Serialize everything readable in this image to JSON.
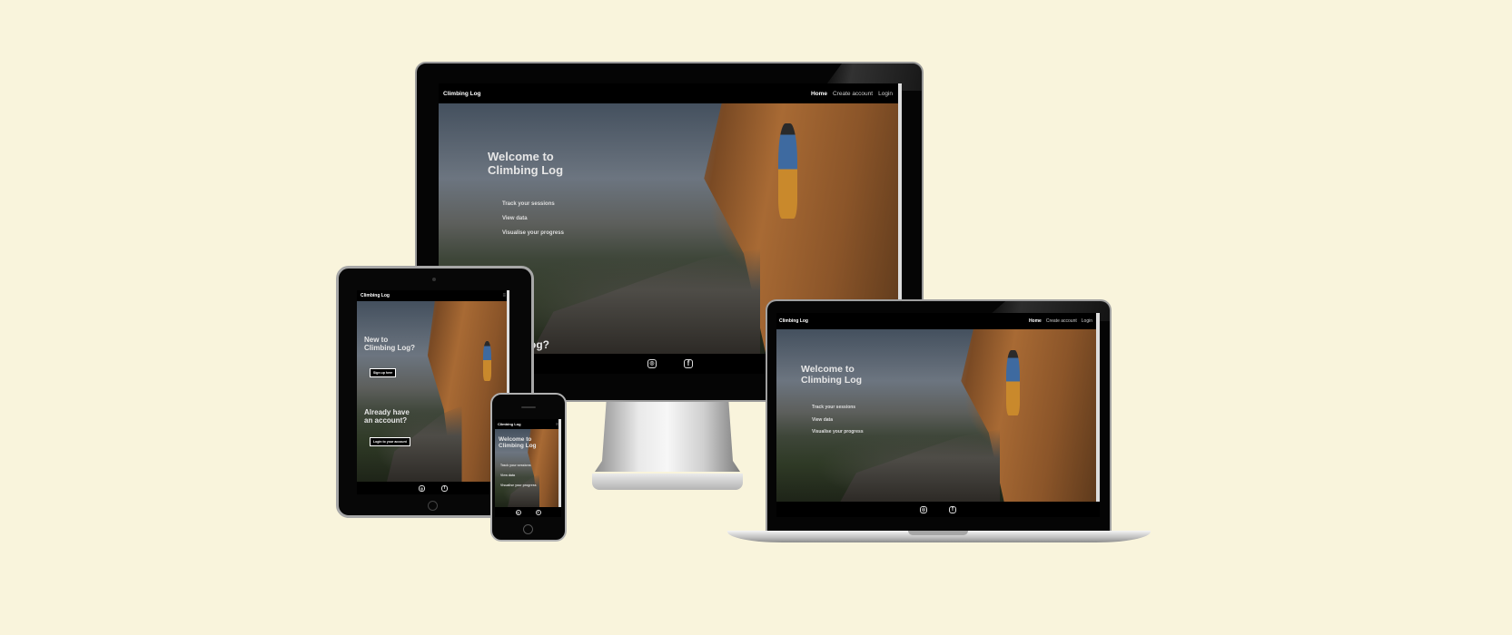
{
  "site": {
    "brand": "Climbing Log",
    "nav": [
      "Home",
      "Create account",
      "Login"
    ]
  },
  "desktop": {
    "heading_1": "Welcome to",
    "heading_2": "Climbing Log",
    "features": [
      "Track your sessions",
      "View data",
      "Visualise your progress"
    ],
    "partial_heading": "g Log?"
  },
  "tablet": {
    "new_heading_1": "New to",
    "new_heading_2": "Climbing Log?",
    "signup_button": "Sign up here",
    "account_heading_1": "Already have",
    "account_heading_2": "an account?",
    "login_button": "Login to your account"
  },
  "phone": {
    "heading_1": "Welcome to",
    "heading_2": "Climbing Log",
    "features": [
      "Track your sessions",
      "View data",
      "Visualise your progress"
    ]
  },
  "laptop": {
    "heading_1": "Welcome to",
    "heading_2": "Climbing Log",
    "features": [
      "Track your sessions",
      "View data",
      "Visualise your progress"
    ]
  },
  "icons": {
    "instagram": "instagram-icon",
    "facebook": "facebook-icon",
    "menu": "hamburger-menu-icon"
  },
  "colors": {
    "background": "#f9f4dc",
    "nav": "#000000",
    "text": "#ffffff"
  }
}
